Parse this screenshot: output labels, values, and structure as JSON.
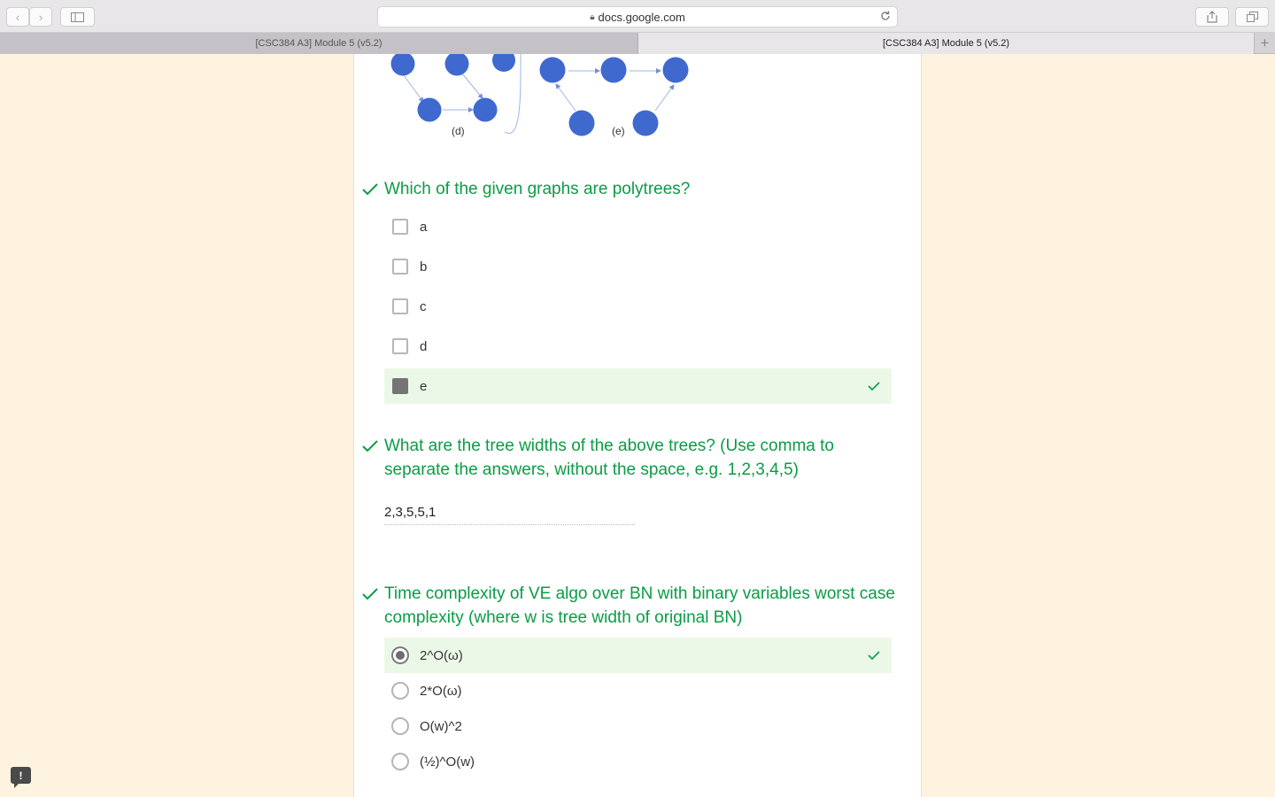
{
  "browser": {
    "url": "docs.google.com",
    "tabs": [
      {
        "label": "[CSC384 A3] Module 5 (v5.2)"
      },
      {
        "label": "[CSC384 A3] Module 5 (v5.2)"
      }
    ]
  },
  "figure": {
    "label_d": "(d)",
    "label_e": "(e)"
  },
  "questions": {
    "polytrees": {
      "title": "Which of the given graphs are polytrees?",
      "options": [
        {
          "label": "a",
          "checked": false
        },
        {
          "label": "b",
          "checked": false
        },
        {
          "label": "c",
          "checked": false
        },
        {
          "label": "d",
          "checked": false
        },
        {
          "label": "e",
          "checked": true,
          "correct": true
        }
      ]
    },
    "tree_widths": {
      "title": "What are the tree widths of the above trees? (Use comma to separate the answers, without the space, e.g. 1,2,3,4,5)",
      "answer": "2,3,5,5,1"
    },
    "complexity": {
      "title": "Time complexity of VE algo over BN with binary variables worst case complexity (where w is tree width of original BN)",
      "options": [
        {
          "label": "2^O(ω)",
          "selected": true,
          "correct": true
        },
        {
          "label": "2*O(ω)",
          "selected": false
        },
        {
          "label": "O(w)^2",
          "selected": false
        },
        {
          "label": "(½)^O(w)",
          "selected": false
        }
      ]
    }
  },
  "colors": {
    "correct_green": "#0a9c45",
    "correct_bg": "#ecf8e7",
    "page_bg": "#fef3de",
    "node_blue": "#3f69cf"
  }
}
